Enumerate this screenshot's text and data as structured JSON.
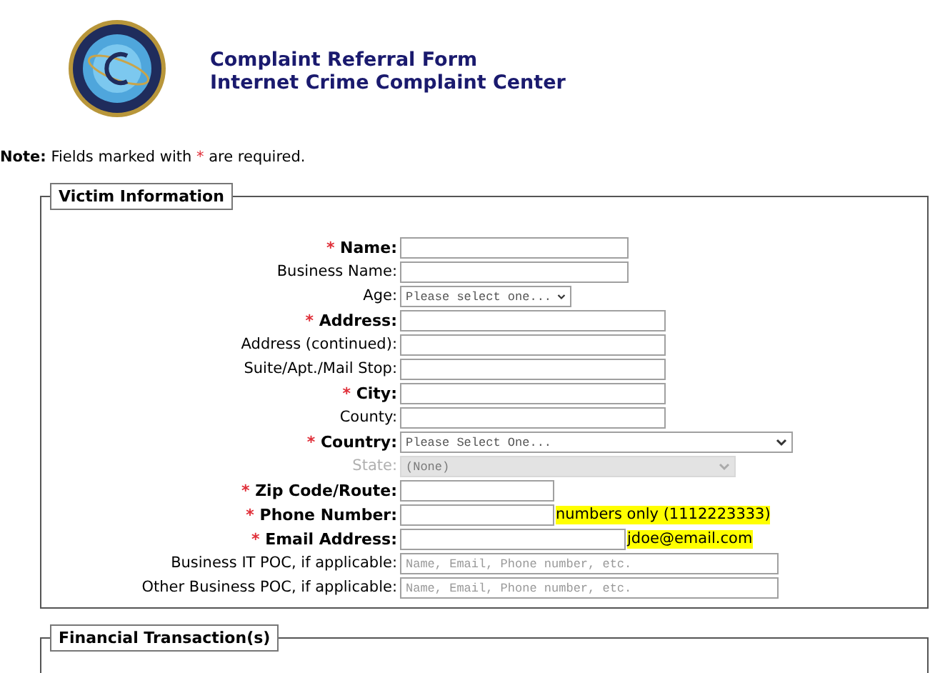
{
  "header": {
    "title_lines": [
      "Complaint Referral Form",
      "Internet Crime Complaint Center"
    ]
  },
  "note": {
    "label": "Note:",
    "text_before": "Fields marked with",
    "mark": "*",
    "text_after": "are required."
  },
  "sections": [
    {
      "legend": "Victim Information",
      "fields": [
        {
          "label": "Name:",
          "required": true,
          "kind": "text"
        },
        {
          "label": "Business Name:",
          "required": false,
          "kind": "text"
        },
        {
          "label": "Age:",
          "required": false,
          "kind": "select",
          "value": "Please select one...",
          "disabled": false
        },
        {
          "label": "Address:",
          "required": true,
          "kind": "text"
        },
        {
          "label": "Address (continued):",
          "required": false,
          "kind": "text"
        },
        {
          "label": "Suite/Apt./Mail Stop:",
          "required": false,
          "kind": "text"
        },
        {
          "label": "City:",
          "required": true,
          "kind": "text"
        },
        {
          "label": "County:",
          "required": false,
          "kind": "text"
        },
        {
          "label": "Country:",
          "required": true,
          "kind": "select",
          "value": "Please Select One...",
          "disabled": false
        },
        {
          "label": "State:",
          "required": false,
          "kind": "select",
          "value": "(None)",
          "disabled": true
        },
        {
          "label": "Zip Code/Route:",
          "required": true,
          "kind": "text"
        },
        {
          "label": "Phone Number:",
          "required": true,
          "kind": "text",
          "hint": "numbers only (1112223333)"
        },
        {
          "label": "Email Address:",
          "required": true,
          "kind": "text",
          "hint": "jdoe@email.com"
        },
        {
          "label": "Business IT POC, if applicable:",
          "required": false,
          "kind": "text",
          "placeholder": "Name, Email, Phone number, etc."
        },
        {
          "label": "Other Business POC, if applicable:",
          "required": false,
          "kind": "text",
          "placeholder": "Name, Email, Phone number, etc."
        }
      ]
    },
    {
      "legend": "Financial Transaction(s)"
    }
  ]
}
